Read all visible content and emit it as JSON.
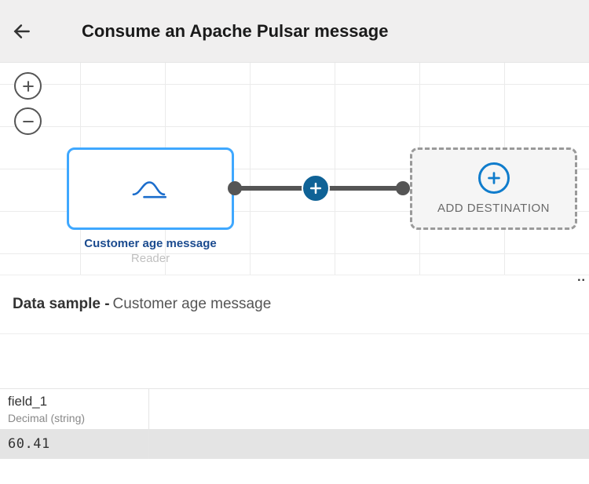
{
  "header": {
    "title": "Consume an Apache Pulsar message"
  },
  "canvas": {
    "zoom_in_icon": "plus",
    "zoom_out_icon": "minus",
    "source": {
      "icon": "source-icon",
      "name": "Customer age message",
      "type": "Reader"
    },
    "edge": {
      "add_icon": "plus"
    },
    "destination": {
      "icon": "plus-circle",
      "label": "ADD DESTINATION"
    }
  },
  "sample": {
    "prefix": "Data sample - ",
    "name": "Customer age message",
    "overflow": "..",
    "columns": [
      {
        "name": "field_1",
        "type": "Decimal (string)"
      }
    ],
    "rows": [
      [
        "60.41"
      ]
    ]
  }
}
